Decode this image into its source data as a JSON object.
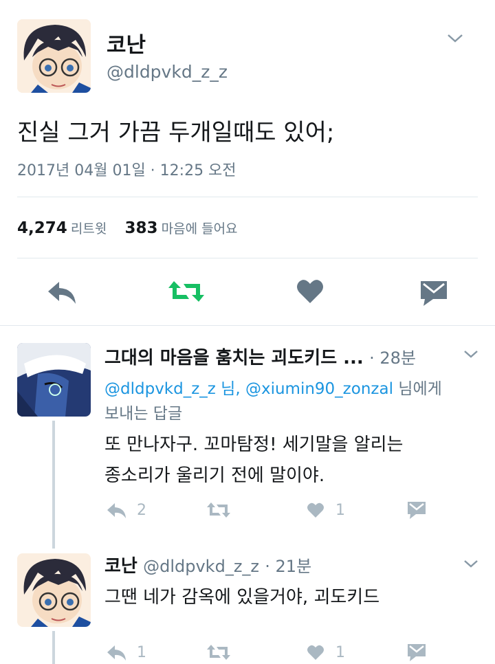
{
  "main_tweet": {
    "display_name": "코난",
    "handle": "@dldpvkd_z_z",
    "text": "진실 그거 가끔 두개일때도 있어;",
    "timestamp": "2017년 04월 01일 · 12:25 오전",
    "retweets_count": "4,274",
    "retweets_label": "리트윗",
    "likes_count": "383",
    "likes_label": "마음에 들어요"
  },
  "replies": [
    {
      "display_name": "그대의 마음을 훔치는 괴도키드 ...",
      "time": "· 28분",
      "reply_to_handles": "@dldpvkd_z_z 님, @xiumin90_zonzal",
      "reply_to_suffix": " 님에게",
      "reply_to_label": "보내는 답글",
      "text_line1": "또 만나자구. 꼬마탐정! 세기말을 알리는",
      "text_line2": "종소리가 울리기 전에 말이야.",
      "reply_count": "2",
      "like_count": "1"
    },
    {
      "display_name": "코난",
      "handle": "@dldpvkd_z_z",
      "time": "· 21분",
      "text": "그땐 네가 감옥에 있을거야, 괴도키드",
      "reply_count": "1",
      "like_count": "1"
    }
  ],
  "colors": {
    "retweet_green": "#17bf63",
    "icon_grey": "#657786",
    "light_icon_grey": "#aab8c2",
    "link_blue": "#1b95e0"
  },
  "icons": [
    "chevron-down-icon",
    "reply-icon",
    "retweet-icon",
    "heart-icon",
    "dm-icon"
  ]
}
